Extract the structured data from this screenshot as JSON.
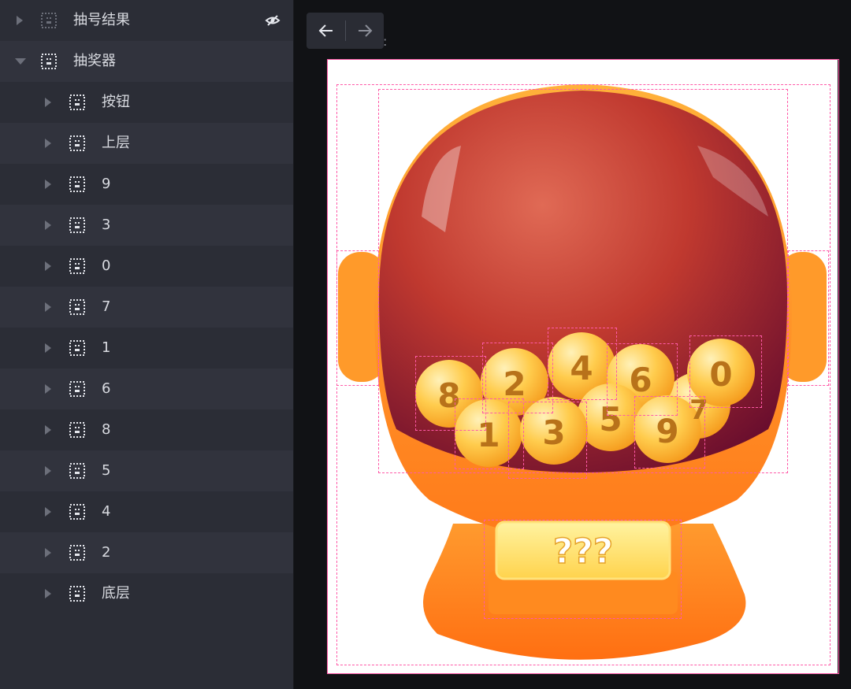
{
  "layers": {
    "items": [
      {
        "label": "抽号结果",
        "hidden": true
      },
      {
        "label": "抽奖器",
        "expanded": true
      },
      {
        "label": "按钮"
      },
      {
        "label": "上层"
      },
      {
        "label": "9"
      },
      {
        "label": "3"
      },
      {
        "label": "0"
      },
      {
        "label": "7"
      },
      {
        "label": "1"
      },
      {
        "label": "6"
      },
      {
        "label": "8"
      },
      {
        "label": "5"
      },
      {
        "label": "4"
      },
      {
        "label": "2"
      },
      {
        "label": "底层"
      }
    ]
  },
  "toolbar": {
    "back_icon": "arrow-left-icon",
    "forward_icon": "arrow-right-icon",
    "colon": ":"
  },
  "machine": {
    "button_text": "???",
    "balls": [
      "8",
      "2",
      "4",
      "6",
      "0",
      "1",
      "3",
      "5",
      "9",
      "7"
    ]
  },
  "colors": {
    "sidebar_bg": "#2b2d36",
    "canvas_bg": "#111215",
    "selection": "#ff5aa8",
    "machine_orange": "#ff8a1f",
    "globe_red": "#b5222c",
    "ball_yellow": "#ffc94a"
  }
}
